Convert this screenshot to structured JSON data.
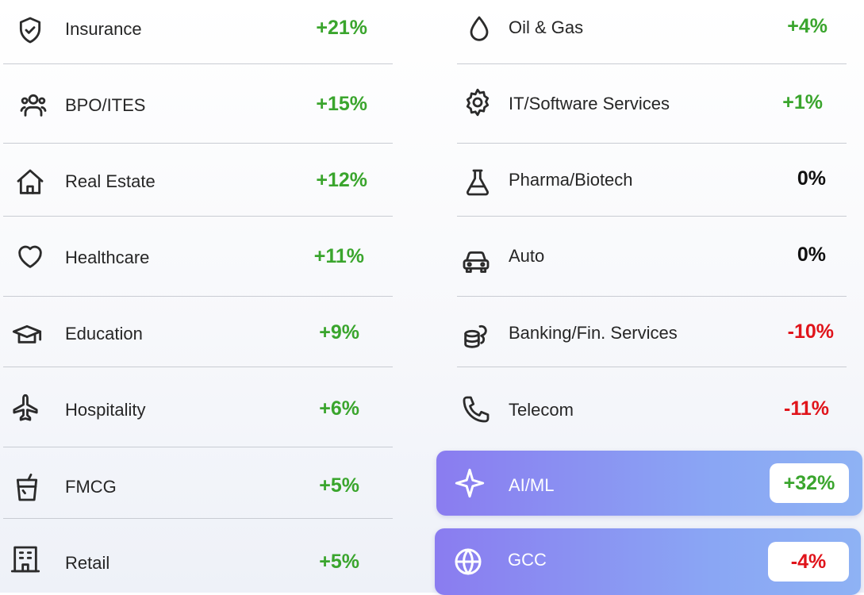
{
  "left": [
    {
      "label": "Insurance",
      "value": "+21%",
      "tone": "pos",
      "icon": "shield-check-icon"
    },
    {
      "label": "BPO/ITES",
      "value": "+15%",
      "tone": "pos",
      "icon": "people-group-icon"
    },
    {
      "label": "Real Estate",
      "value": "+12%",
      "tone": "pos",
      "icon": "house-icon"
    },
    {
      "label": "Healthcare",
      "value": "+11%",
      "tone": "pos",
      "icon": "heart-icon"
    },
    {
      "label": "Education",
      "value": "+9%",
      "tone": "pos",
      "icon": "graduation-cap-icon"
    },
    {
      "label": "Hospitality",
      "value": "+6%",
      "tone": "pos",
      "icon": "airplane-icon"
    },
    {
      "label": "FMCG",
      "value": "+5%",
      "tone": "pos",
      "icon": "drink-cup-icon"
    },
    {
      "label": "Retail",
      "value": "+5%",
      "tone": "pos",
      "icon": "store-building-icon"
    }
  ],
  "right": [
    {
      "label": "Oil & Gas",
      "value": "+4%",
      "tone": "pos",
      "icon": "drop-icon"
    },
    {
      "label": "IT/Software Services",
      "value": "+1%",
      "tone": "pos",
      "icon": "gear-icon"
    },
    {
      "label": "Pharma/Biotech",
      "value": "0%",
      "tone": "zero",
      "icon": "flask-icon"
    },
    {
      "label": "Auto",
      "value": "0%",
      "tone": "zero",
      "icon": "car-icon"
    },
    {
      "label": "Banking/Fin. Services",
      "value": "-10%",
      "tone": "neg",
      "icon": "coins-icon"
    },
    {
      "label": "Telecom",
      "value": "-11%",
      "tone": "neg",
      "icon": "phone-icon"
    }
  ],
  "highlight": [
    {
      "label": "AI/ML",
      "value": "+32%",
      "tone": "pos",
      "icon": "sparkle-icon"
    },
    {
      "label": "GCC",
      "value": "-4%",
      "tone": "neg",
      "icon": "globe-icon"
    }
  ],
  "colors": {
    "positive": "#3aa52d",
    "negative": "#e0141b",
    "neutral": "#111111",
    "highlight_start": "#8a7cf0",
    "highlight_end": "#8eb2f4"
  }
}
